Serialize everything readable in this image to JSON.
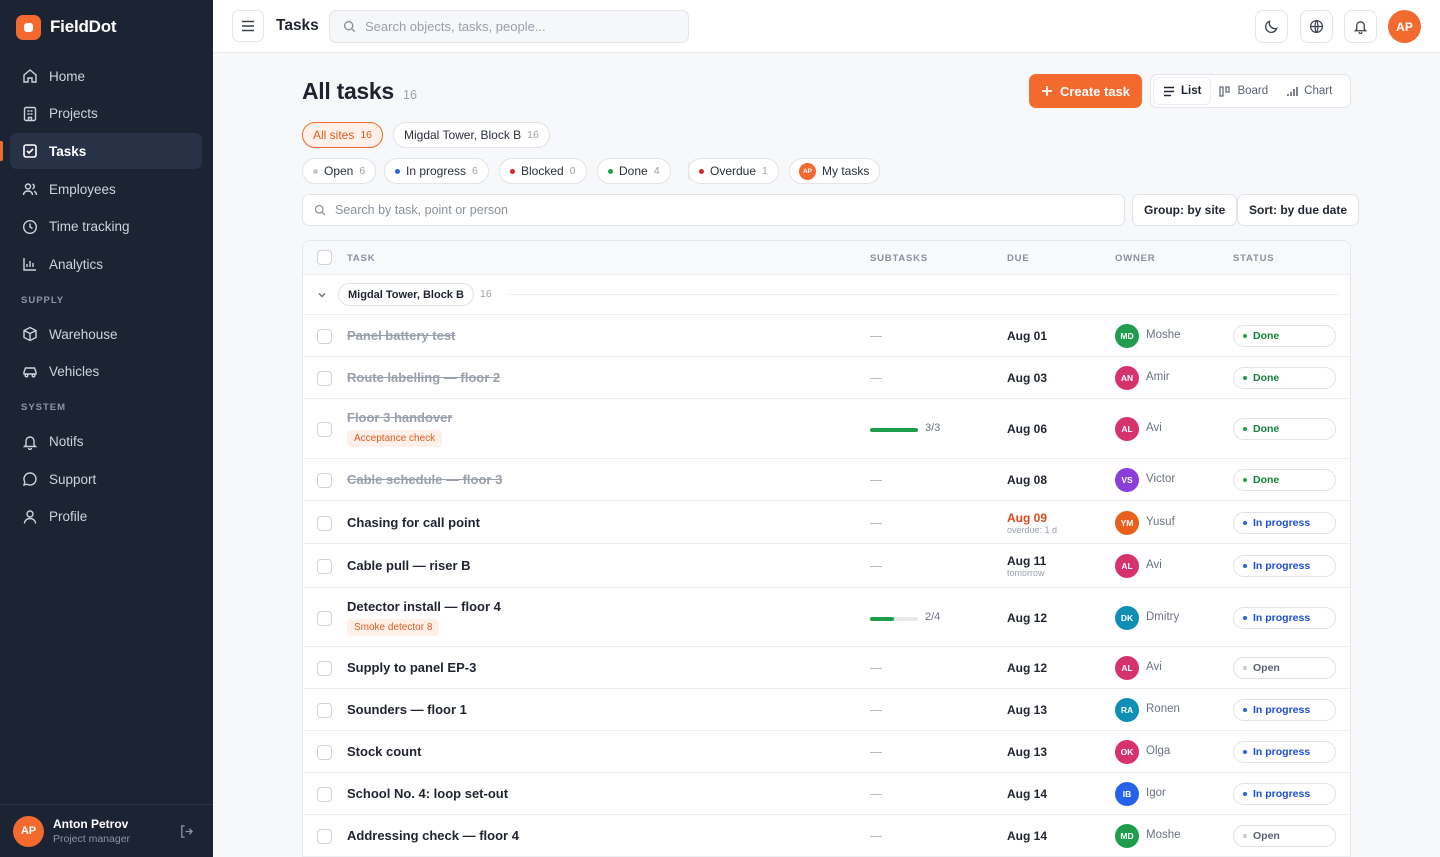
{
  "app": {
    "name": "FieldDot"
  },
  "sidebar": {
    "nav": [
      {
        "label": "Home",
        "icon": "home-icon",
        "active": false
      },
      {
        "label": "Projects",
        "icon": "building-icon",
        "active": false
      },
      {
        "label": "Tasks",
        "icon": "checkbox-icon",
        "active": true
      },
      {
        "label": "Employees",
        "icon": "users-icon",
        "active": false
      }
    ],
    "nav2": [
      {
        "label": "Time tracking",
        "icon": "clock-icon"
      },
      {
        "label": "Analytics",
        "icon": "bar-chart-icon"
      }
    ],
    "supply_label": "SUPPLY",
    "supply": [
      {
        "label": "Warehouse",
        "icon": "box-icon"
      },
      {
        "label": "Vehicles",
        "icon": "car-icon"
      }
    ],
    "system_label": "SYSTEM",
    "system": [
      {
        "label": "Notifs",
        "icon": "bell-icon"
      },
      {
        "label": "Support",
        "icon": "chat-icon"
      },
      {
        "label": "Profile",
        "icon": "user-icon"
      }
    ],
    "user": {
      "initials": "AP",
      "name": "Anton Petrov",
      "role": "Project manager"
    }
  },
  "topbar": {
    "title": "Tasks",
    "search_placeholder": "Search objects, tasks, people...",
    "avatar": "AP"
  },
  "page": {
    "title": "All tasks",
    "count": "16",
    "create_label": "Create task",
    "views": [
      "List",
      "Board",
      "Chart"
    ],
    "active_view": "List"
  },
  "site_filters": [
    {
      "label": "All sites",
      "count": "16",
      "active": true
    },
    {
      "label": "Migdal Tower, Block B",
      "count": "16",
      "active": false
    }
  ],
  "status_filters": [
    {
      "label": "Open",
      "count": "6",
      "color": "#c4c8cf"
    },
    {
      "label": "In progress",
      "count": "6",
      "color": "#2563eb"
    },
    {
      "label": "Blocked",
      "count": "0",
      "color": "#dc2626"
    },
    {
      "label": "Done",
      "count": "4",
      "color": "#16a34a"
    }
  ],
  "extra_filters": {
    "overdue": {
      "label": "Overdue",
      "count": "1",
      "color": "#dc2626"
    },
    "my_tasks": {
      "label": "My tasks",
      "avatar": "AP"
    }
  },
  "list_search_placeholder": "Search by task, point or person",
  "group_by": "Group: by site",
  "sort_by": "Sort: by due date",
  "table": {
    "columns": [
      "TASK",
      "SUBTASKS",
      "DUE",
      "OWNER",
      "STATUS"
    ],
    "group": {
      "label": "Migdal Tower, Block B",
      "count": "16"
    },
    "rows": [
      {
        "title": "Panel battery test",
        "done": true,
        "tag": "",
        "subtasks": "",
        "progress": 0,
        "due": "Aug 01",
        "due_sub": "",
        "overdue": false,
        "owner_initials": "MD",
        "owner": "Moshe",
        "owner_color": "#1e9e4d",
        "status": "Done"
      },
      {
        "title": "Route labelling — floor 2",
        "done": true,
        "tag": "",
        "subtasks": "",
        "progress": 0,
        "due": "Aug 03",
        "due_sub": "",
        "overdue": false,
        "owner_initials": "AN",
        "owner": "Amir",
        "owner_color": "#d6336c",
        "status": "Done"
      },
      {
        "title": "Floor 3 handover",
        "done": true,
        "tag": "Acceptance check",
        "subtasks": "3/3",
        "progress": 1,
        "due": "Aug 06",
        "due_sub": "",
        "overdue": false,
        "owner_initials": "AL",
        "owner": "Avi",
        "owner_color": "#d6336c",
        "status": "Done"
      },
      {
        "title": "Cable schedule — floor 3",
        "done": true,
        "tag": "",
        "subtasks": "",
        "progress": 0,
        "due": "Aug 08",
        "due_sub": "",
        "overdue": false,
        "owner_initials": "VS",
        "owner": "Victor",
        "owner_color": "#8b3fd9",
        "status": "Done"
      },
      {
        "title": "Chasing for call point",
        "done": false,
        "tag": "",
        "subtasks": "",
        "progress": 0,
        "due": "Aug 09",
        "due_sub": "overdue: 1 d",
        "overdue": true,
        "owner_initials": "YM",
        "owner": "Yusuf",
        "owner_color": "#e8601c",
        "status": "In progress"
      },
      {
        "title": "Cable pull — riser B",
        "done": false,
        "tag": "",
        "subtasks": "",
        "progress": 0,
        "due": "Aug 11",
        "due_sub": "tomorrow",
        "overdue": false,
        "owner_initials": "AL",
        "owner": "Avi",
        "owner_color": "#d6336c",
        "status": "In progress"
      },
      {
        "title": "Detector install — floor 4",
        "done": false,
        "tag": "Smoke detector 8",
        "subtasks": "2/4",
        "progress": 0.5,
        "due": "Aug 12",
        "due_sub": "",
        "overdue": false,
        "owner_initials": "DK",
        "owner": "Dmitry",
        "owner_color": "#0e8fb3",
        "status": "In progress"
      },
      {
        "title": "Supply to panel EP-3",
        "done": false,
        "tag": "",
        "subtasks": "",
        "progress": 0,
        "due": "Aug 12",
        "due_sub": "",
        "overdue": false,
        "owner_initials": "AL",
        "owner": "Avi",
        "owner_color": "#d6336c",
        "status": "Open"
      },
      {
        "title": "Sounders — floor 1",
        "done": false,
        "tag": "",
        "subtasks": "",
        "progress": 0,
        "due": "Aug 13",
        "due_sub": "",
        "overdue": false,
        "owner_initials": "RA",
        "owner": "Ronen",
        "owner_color": "#0e8fb3",
        "status": "In progress"
      },
      {
        "title": "Stock count",
        "done": false,
        "tag": "",
        "subtasks": "",
        "progress": 0,
        "due": "Aug 13",
        "due_sub": "",
        "overdue": false,
        "owner_initials": "OK",
        "owner": "Olga",
        "owner_color": "#d6336c",
        "status": "In progress"
      },
      {
        "title": "School No. 4: loop set-out",
        "done": false,
        "tag": "",
        "subtasks": "",
        "progress": 0,
        "due": "Aug 14",
        "due_sub": "",
        "overdue": false,
        "owner_initials": "IB",
        "owner": "Igor",
        "owner_color": "#2563eb",
        "status": "In progress"
      },
      {
        "title": "Addressing check — floor 4",
        "done": false,
        "tag": "",
        "subtasks": "",
        "progress": 0,
        "due": "Aug 14",
        "due_sub": "",
        "overdue": false,
        "owner_initials": "MD",
        "owner": "Moshe",
        "owner_color": "#1e9e4d",
        "status": "Open"
      }
    ]
  },
  "status_colors": {
    "Done": "#16a34a",
    "In progress": "#2563eb",
    "Open": "#c4c8cf"
  },
  "status_text_colors": {
    "Done": "#15803d",
    "In progress": "#1d4ed8",
    "Open": "#5b6270"
  }
}
